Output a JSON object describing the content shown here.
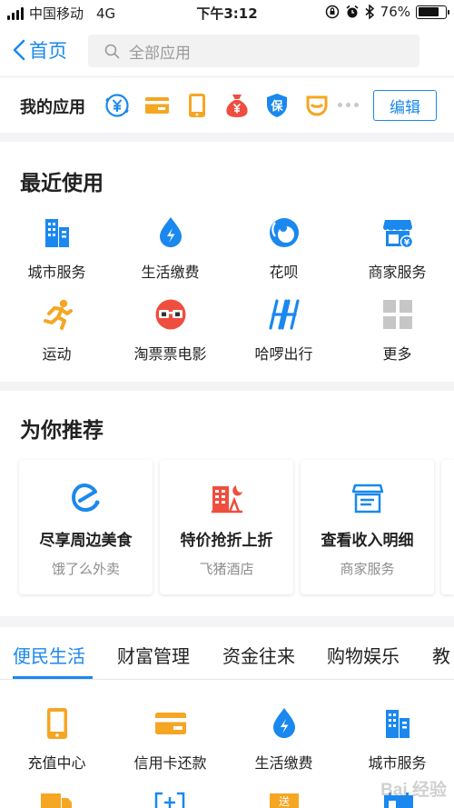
{
  "status_bar": {
    "carrier": "中国移动",
    "network": "4G",
    "time": "下午3:12",
    "battery": "76%",
    "battery_level": 0.76
  },
  "nav": {
    "back_label": "首页",
    "search_placeholder": "全部应用"
  },
  "my_apps": {
    "title": "我的应用",
    "icons": [
      "yuan-circle-icon",
      "credit-card-icon",
      "phone-icon",
      "money-bag-icon",
      "shield-icon",
      "cup-icon"
    ],
    "edit_label": "编辑"
  },
  "recent": {
    "title": "最近使用",
    "items": [
      {
        "label": "城市服务",
        "icon": "building-icon"
      },
      {
        "label": "生活缴费",
        "icon": "water-drop-icon"
      },
      {
        "label": "花呗",
        "icon": "huabei-icon"
      },
      {
        "label": "商家服务",
        "icon": "store-icon"
      },
      {
        "label": "运动",
        "icon": "running-icon"
      },
      {
        "label": "淘票票电影",
        "icon": "glasses-icon"
      },
      {
        "label": "哈啰出行",
        "icon": "hello-bike-icon"
      },
      {
        "label": "更多",
        "icon": "grid-more-icon"
      }
    ]
  },
  "recommend": {
    "title": "为你推荐",
    "cards": [
      {
        "title": "尽享周边美食",
        "subtitle": "饿了么外卖",
        "icon": "eleme-icon"
      },
      {
        "title": "特价抢折上折",
        "subtitle": "飞猪酒店",
        "icon": "hotel-icon"
      },
      {
        "title": "查看收入明细",
        "subtitle": "商家服务",
        "icon": "store-icon"
      }
    ]
  },
  "tabs": {
    "items": [
      "便民生活",
      "财富管理",
      "资金往来",
      "购物娱乐",
      "教"
    ],
    "active": 0
  },
  "bottom": {
    "items": [
      {
        "label": "充值中心",
        "icon": "phone-icon"
      },
      {
        "label": "信用卡还款",
        "icon": "credit-card-icon"
      },
      {
        "label": "生活缴费",
        "icon": "water-drop-icon"
      },
      {
        "label": "城市服务",
        "icon": "building-icon"
      }
    ]
  },
  "watermark": "Bai 经验",
  "colors": {
    "accent": "#1a88ee",
    "orange": "#f5a623",
    "red": "#ef4e3f"
  }
}
